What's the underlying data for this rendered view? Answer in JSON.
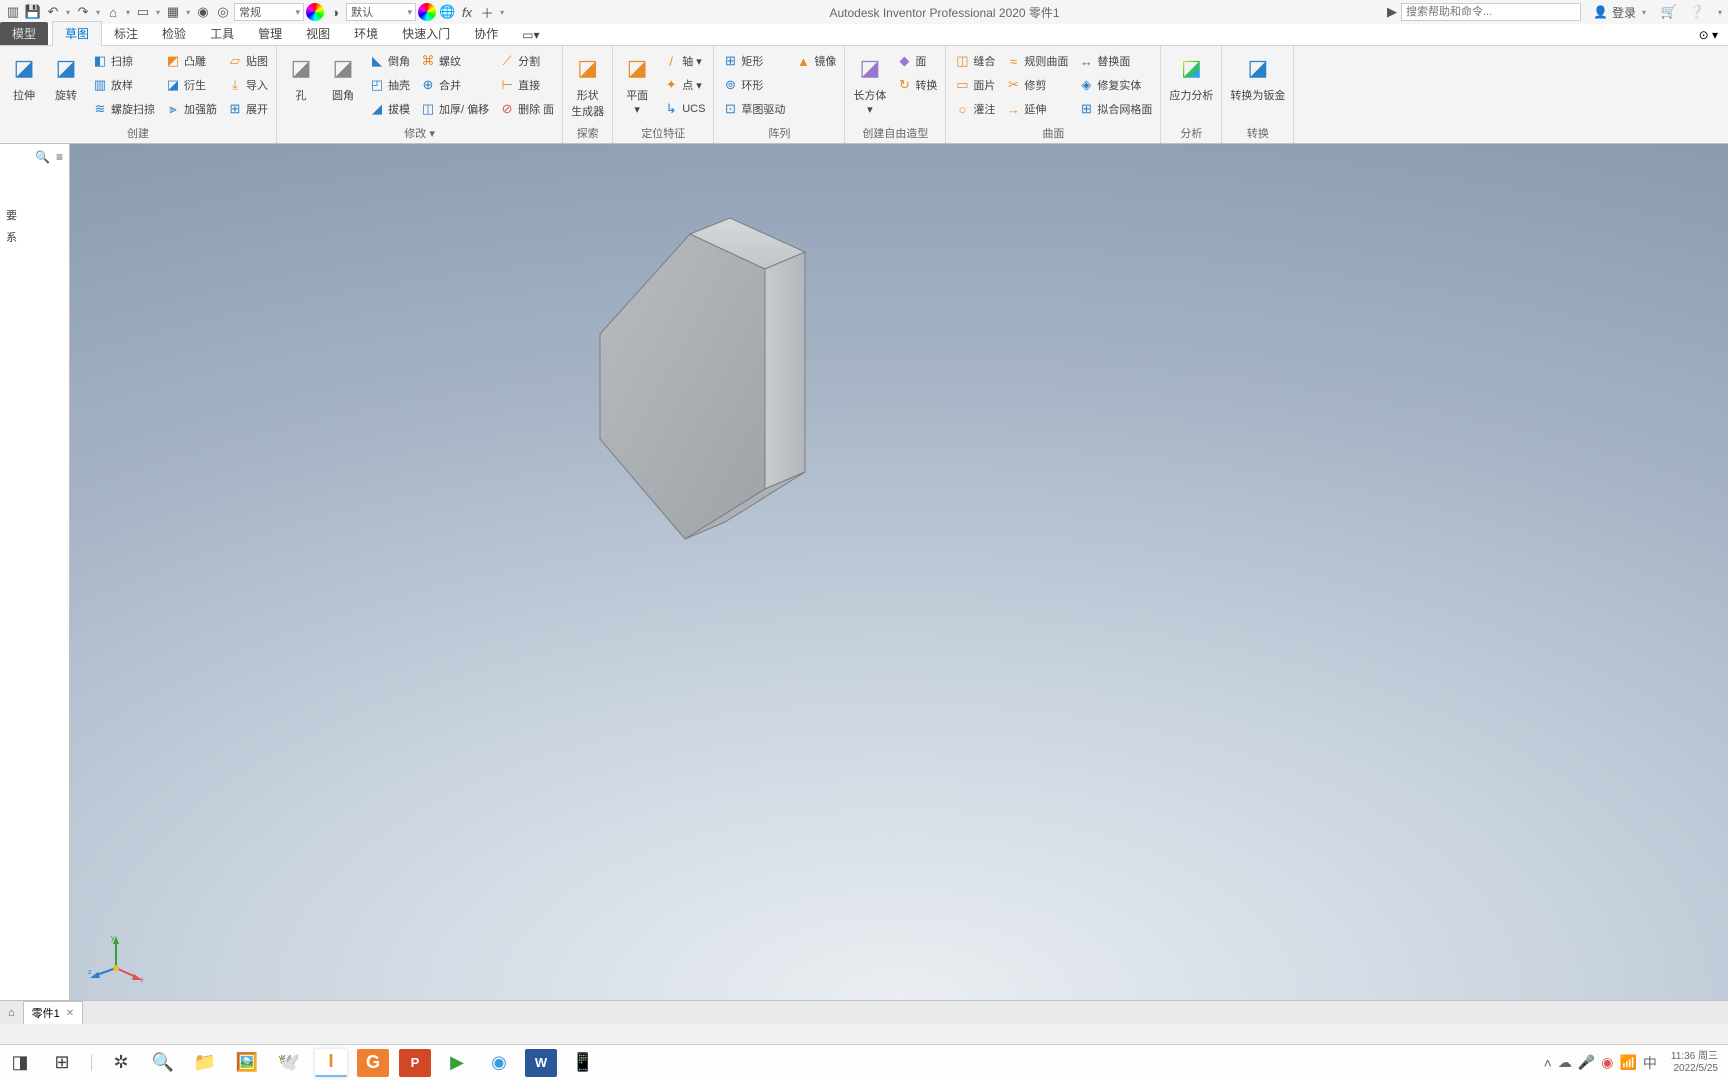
{
  "titlebar": {
    "style_combo": "常规",
    "appearance_combo": "默认",
    "app_title": "Autodesk Inventor Professional 2020  零件1",
    "search_placeholder": "搜索帮助和命令...",
    "login": "登录"
  },
  "tabs": {
    "file": "模型",
    "items": [
      "草图",
      "标注",
      "检验",
      "工具",
      "管理",
      "视图",
      "环境",
      "快速入门",
      "协作"
    ]
  },
  "ribbon": {
    "panels": [
      {
        "title": "创建",
        "big": [
          {
            "label": "拉伸",
            "iconClass": "icon-blue"
          },
          {
            "label": "旋转",
            "iconClass": "icon-blue"
          }
        ],
        "stack": [
          {
            "icon": "◧",
            "iconClass": "icon-blue",
            "label": "扫掠"
          },
          {
            "icon": "▥",
            "iconClass": "icon-blue",
            "label": "放样"
          },
          {
            "icon": "≋",
            "iconClass": "icon-blue",
            "label": "螺旋扫掠"
          }
        ],
        "stack2": [
          {
            "icon": "◩",
            "iconClass": "icon-orange",
            "label": "凸雕"
          },
          {
            "icon": "◪",
            "iconClass": "icon-blue",
            "label": "衍生"
          },
          {
            "icon": "⫸",
            "iconClass": "icon-blue",
            "label": "加强筋"
          }
        ],
        "stack3": [
          {
            "icon": "▱",
            "iconClass": "icon-orange",
            "label": "贴图"
          },
          {
            "icon": "⤓",
            "iconClass": "icon-orange",
            "label": "导入"
          },
          {
            "icon": "⊞",
            "iconClass": "icon-blue",
            "label": "展开"
          }
        ]
      },
      {
        "title": "修改 ▾",
        "big": [
          {
            "label": "孔",
            "iconClass": "icon-gray"
          },
          {
            "label": "圆角",
            "iconClass": "icon-gray"
          }
        ],
        "stack": [
          {
            "icon": "◣",
            "iconClass": "icon-blue",
            "label": "倒角"
          },
          {
            "icon": "◰",
            "iconClass": "icon-blue",
            "label": "抽壳"
          },
          {
            "icon": "◢",
            "iconClass": "icon-blue",
            "label": "拔模"
          }
        ],
        "stack2": [
          {
            "icon": "⌘",
            "iconClass": "icon-orange",
            "label": "螺纹"
          },
          {
            "icon": "⊕",
            "iconClass": "icon-blue",
            "label": "合并"
          },
          {
            "icon": "◫",
            "iconClass": "icon-blue",
            "label": "加厚/ 偏移"
          }
        ],
        "stack3": [
          {
            "icon": "⟋",
            "iconClass": "icon-orange",
            "label": "分割"
          },
          {
            "icon": "⊢",
            "iconClass": "icon-orange",
            "label": "直接"
          },
          {
            "icon": "⊘",
            "iconClass": "icon-red",
            "label": "删除 面"
          }
        ]
      },
      {
        "title": "探索",
        "big": [
          {
            "label": "形状\n生成器",
            "iconClass": "icon-orange"
          }
        ]
      },
      {
        "title": "定位特征",
        "big": [
          {
            "label": "平面",
            "iconClass": "icon-orange",
            "dropdown": true
          }
        ],
        "stack": [
          {
            "icon": "/",
            "iconClass": "icon-orange",
            "label": "轴 ▾"
          },
          {
            "icon": "✦",
            "iconClass": "icon-orange",
            "label": "点 ▾"
          },
          {
            "icon": "↳",
            "iconClass": "icon-blue",
            "label": "UCS"
          }
        ]
      },
      {
        "title": "阵列",
        "stack": [
          {
            "icon": "⊞",
            "iconClass": "icon-blue",
            "label": "矩形"
          },
          {
            "icon": "⊚",
            "iconClass": "icon-blue",
            "label": "环形"
          },
          {
            "icon": "⊡",
            "iconClass": "icon-blue",
            "label": "草图驱动"
          }
        ],
        "stack2": [
          {
            "icon": "▲",
            "iconClass": "icon-orange",
            "label": "镜像"
          }
        ]
      },
      {
        "title": "创建自由造型",
        "big": [
          {
            "label": "长方体",
            "iconClass": "icon-purple",
            "dropdown": true
          }
        ],
        "stack": [
          {
            "icon": "◆",
            "iconClass": "icon-purple",
            "label": "面"
          },
          {
            "icon": "↻",
            "iconClass": "icon-orange",
            "label": "转换"
          }
        ]
      },
      {
        "title": "曲面",
        "stack": [
          {
            "icon": "◫",
            "iconClass": "icon-orange",
            "label": "缝合"
          },
          {
            "icon": "▭",
            "iconClass": "icon-orange",
            "label": "面片"
          },
          {
            "icon": "○",
            "iconClass": "icon-orange",
            "label": "灌注"
          }
        ],
        "stack2": [
          {
            "icon": "≈",
            "iconClass": "icon-orange",
            "label": "规则曲面"
          },
          {
            "icon": "✂",
            "iconClass": "icon-orange",
            "label": "修剪"
          },
          {
            "icon": "→",
            "iconClass": "icon-orange",
            "label": "延伸"
          }
        ],
        "stack3": [
          {
            "icon": "↔",
            "iconClass": "icon-blue",
            "label": "替换面"
          },
          {
            "icon": "◈",
            "iconClass": "icon-blue",
            "label": "修复实体"
          },
          {
            "icon": "⊞",
            "iconClass": "icon-blue",
            "label": "拟合网格面"
          }
        ]
      },
      {
        "title": "分析",
        "big": [
          {
            "label": "应力分析",
            "iconClass": "icon-rainbow"
          }
        ]
      },
      {
        "title": "转换",
        "big": [
          {
            "label": "转换为钣金",
            "iconClass": "icon-blue"
          }
        ]
      }
    ]
  },
  "browser": {
    "nodes": [
      "要",
      "系"
    ]
  },
  "doctabs": {
    "active": "零件1"
  },
  "taskbar": {
    "time": "11:36",
    "day": "周三",
    "date": "2022/5/25",
    "ime": "中"
  }
}
